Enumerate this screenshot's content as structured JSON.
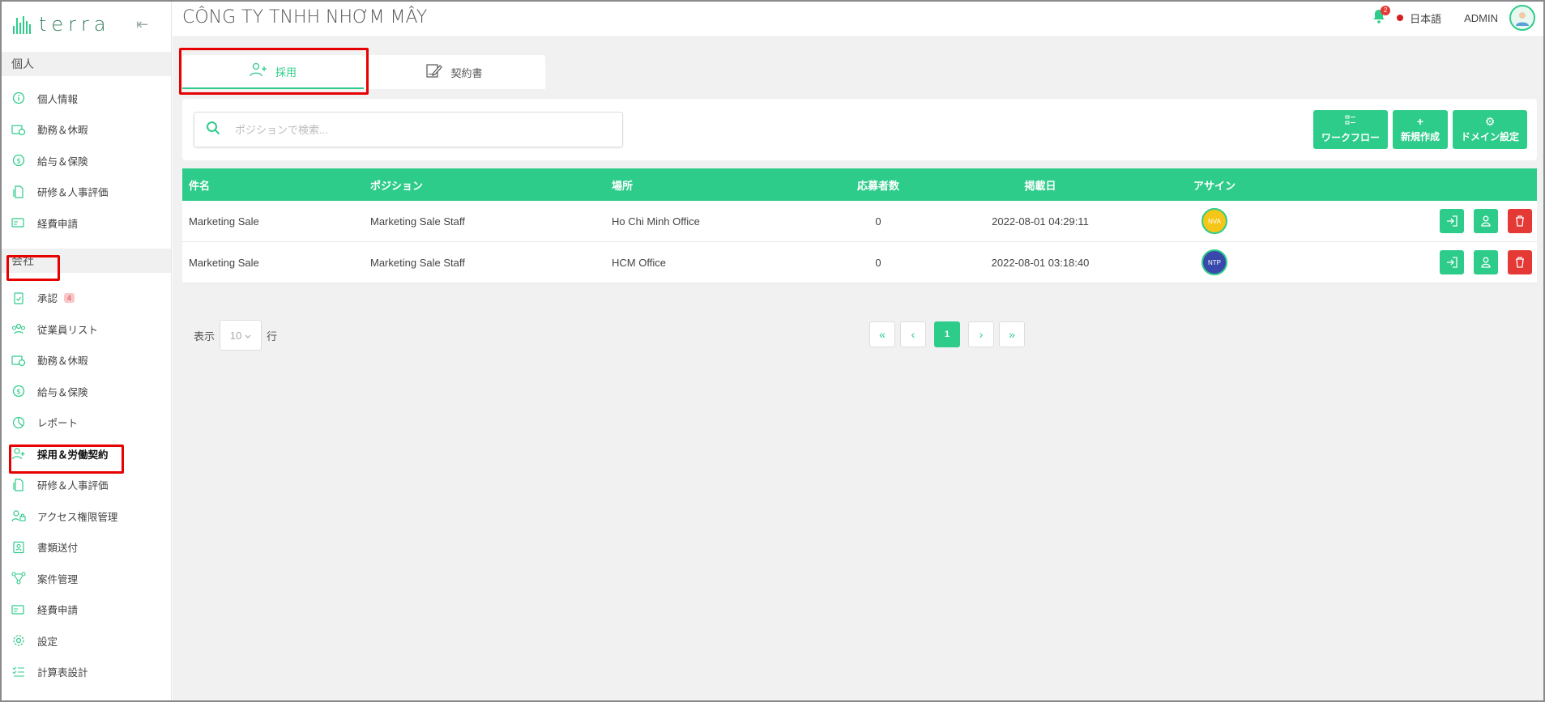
{
  "brand": {
    "name": "terra"
  },
  "sidebar": {
    "personal_header": "個人",
    "personal_items": [
      {
        "label": "個人情報",
        "icon": "info-icon"
      },
      {
        "label": "勤務＆休暇",
        "icon": "calendar-clock-icon"
      },
      {
        "label": "給与＆保険",
        "icon": "dollar-icon"
      },
      {
        "label": "研修＆人事評価",
        "icon": "document-icon"
      },
      {
        "label": "経費申請",
        "icon": "card-icon"
      }
    ],
    "company_header": "会社",
    "company_items": [
      {
        "label": "承認",
        "icon": "clipboard-check-icon",
        "badge": "4"
      },
      {
        "label": "従業員リスト",
        "icon": "users-icon"
      },
      {
        "label": "勤務＆休暇",
        "icon": "calendar-clock-icon"
      },
      {
        "label": "給与＆保険",
        "icon": "dollar-icon"
      },
      {
        "label": "レポート",
        "icon": "pie-chart-icon"
      },
      {
        "label": "採用＆労働契約",
        "icon": "user-plus-icon"
      },
      {
        "label": "研修＆人事評価",
        "icon": "document-icon"
      },
      {
        "label": "アクセス権限管理",
        "icon": "user-lock-icon"
      },
      {
        "label": "書類送付",
        "icon": "id-card-icon"
      },
      {
        "label": "案件管理",
        "icon": "network-icon"
      },
      {
        "label": "経費申請",
        "icon": "card-icon"
      },
      {
        "label": "設定",
        "icon": "gear-icon"
      },
      {
        "label": "計算表設計",
        "icon": "checklist-icon"
      }
    ]
  },
  "topbar": {
    "company": "CÔNG TY TNHH NHƠM MÂY",
    "notification_count": "2",
    "language": "日本語",
    "user": "ADMIN"
  },
  "tabs": [
    {
      "label": "採用",
      "icon": "user-plus-icon"
    },
    {
      "label": "契約書",
      "icon": "signature-icon"
    }
  ],
  "search": {
    "placeholder": "ポジションで検索..."
  },
  "actions": {
    "workflow": "ワークフロー",
    "create": "新規作成",
    "domain": "ドメイン設定"
  },
  "table": {
    "headers": [
      "件名",
      "ポジション",
      "場所",
      "応募者数",
      "掲載日",
      "アサイン"
    ],
    "rows": [
      {
        "title": "Marketing Sale",
        "position": "Marketing Sale Staff",
        "location": "Ho Chi Minh Office",
        "applicants": "0",
        "posted": "2022-08-01 04:29:11",
        "assignee": "NVA",
        "assignee_color": "#f5c518"
      },
      {
        "title": "Marketing Sale",
        "position": "Marketing Sale Staff",
        "location": "HCM Office",
        "applicants": "0",
        "posted": "2022-08-01 03:18:40",
        "assignee": "NTP",
        "assignee_color": "#3949ab"
      }
    ]
  },
  "footer": {
    "show_label": "表示",
    "page_size": "10",
    "rows_label": "行",
    "current_page": "1"
  },
  "colors": {
    "accent": "#2ecc8a",
    "danger": "#e53935",
    "highlight": "#e60000"
  }
}
